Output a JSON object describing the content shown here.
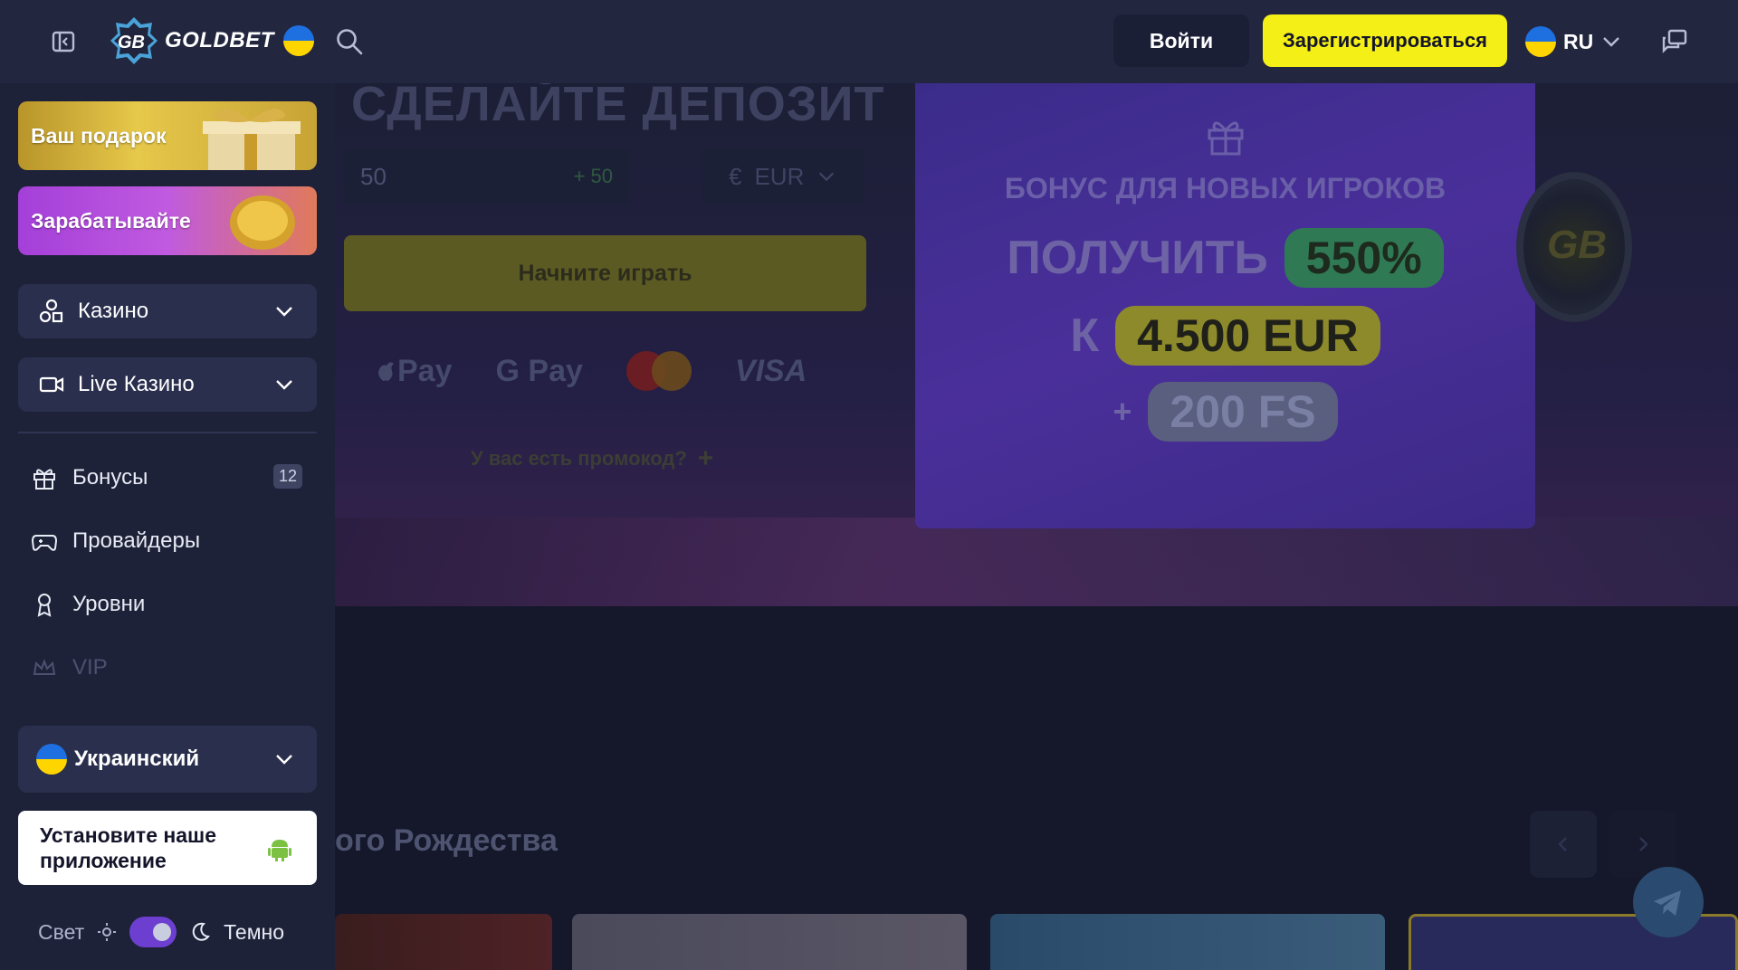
{
  "header": {
    "logo_text": "GOLDBET",
    "login_label": "Войти",
    "register_label": "Зарегистрироваться",
    "language_code": "RU",
    "icons": [
      "sidebar-toggle-icon",
      "search-icon",
      "chevron-down-icon",
      "chat-icon"
    ]
  },
  "sidebar": {
    "promos": [
      {
        "label": "Ваш подарок"
      },
      {
        "label": "Зарабатывайте"
      }
    ],
    "dropdowns": [
      {
        "label": "Казино",
        "icon": "casino-icon"
      },
      {
        "label": "Live Казино",
        "icon": "video-camera-icon"
      }
    ],
    "items": [
      {
        "label": "Бонусы",
        "icon": "gift-icon",
        "badge": "12"
      },
      {
        "label": "Провайдеры",
        "icon": "gamepad-icon"
      },
      {
        "label": "Уровни",
        "icon": "award-icon"
      },
      {
        "label": "VIP",
        "icon": "crown-icon"
      }
    ],
    "language_select": "Украинский",
    "install_app": "Установите наше приложение",
    "theme": {
      "light_label": "Свет",
      "dark_label": "Темно",
      "active": "dark"
    }
  },
  "main": {
    "deposit": {
      "title": "СДЕЛАЙТЕ ДЕПОЗИТ",
      "amount_value": "50",
      "amount_bonus": "+ 50",
      "currency_symbol": "€",
      "currency": "EUR",
      "start_button": "Начните играть",
      "payments": [
        "Pay",
        "G Pay",
        "VISA"
      ],
      "promo_link": "У вас есть промокод?",
      "promo_plus": "+"
    },
    "bonus": {
      "subtitle": "БОНУС ДЛЯ НОВЫХ ИГРОКОВ",
      "line1_text": "ПОЛУЧИТЬ",
      "line1_value": "550%",
      "line2_text": "К",
      "line2_value": "4.500 EUR",
      "line3_prefix": "+",
      "line3_value": "200 FS"
    },
    "chip_text": "GB",
    "section_title": "ого Рождества",
    "colors": {
      "accent_yellow": "#f4ef16",
      "header_bg": "#22263f",
      "sidebar_bg": "#1e2239"
    }
  }
}
